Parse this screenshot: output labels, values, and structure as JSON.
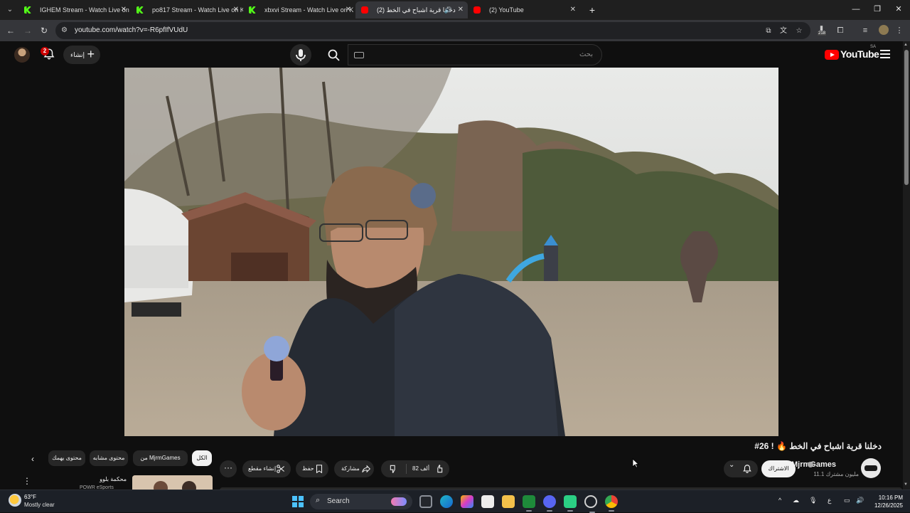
{
  "browser": {
    "tabs": [
      {
        "title": "IGHEM Stream - Watch Live on K",
        "favicon": "kick-icon",
        "active": false
      },
      {
        "title": "po817 Stream - Watch Live on K",
        "favicon": "kick-icon",
        "active": false
      },
      {
        "title": "xbxvi Stream - Watch Live on K",
        "favicon": "kick-icon",
        "active": false
      },
      {
        "title": "(2) دخلنا قرية اشباح في الخط",
        "favicon": "youtube-icon",
        "active": true,
        "audio": true
      },
      {
        "title": "(2) YouTube",
        "favicon": "youtube-icon",
        "active": false
      }
    ],
    "url": "youtube.com/watch?v=-R6pfIfVUdU",
    "extension_badge": "218"
  },
  "youtube": {
    "create_label": "إنشاء",
    "notification_count": "2",
    "search_placeholder": "بحث",
    "logo_text": "YouTube",
    "logo_country": "SA",
    "brand_color": "#ff0000"
  },
  "video": {
    "title": "دخلنا قرية اشباح في الخط 🔥 ! 26#",
    "channel_name": "MjrmGames",
    "subscribers": "11.1 مليون مشترك",
    "subscribe_label": "الاشتراك",
    "like_count": "82 ألف",
    "share_label": "مشاركة",
    "save_label": "حفظ",
    "clip_label": "إنشاء مقطع"
  },
  "chips": [
    {
      "label": "الكل",
      "active": true
    },
    {
      "label": "من MjrmGames",
      "active": false
    },
    {
      "label": "محتوى مشابه",
      "active": false
    },
    {
      "label": "محتوى يهمك",
      "active": false
    }
  ],
  "recommendation": {
    "title": "محكمة بلوو",
    "subtitle": "POWR eSports"
  },
  "taskbar": {
    "weather_temp": "63°F",
    "weather_desc": "Mostly clear",
    "search_label": "Search",
    "keyboard_lang": "ع",
    "time": "10:16 PM",
    "date": "12/26/2025"
  }
}
